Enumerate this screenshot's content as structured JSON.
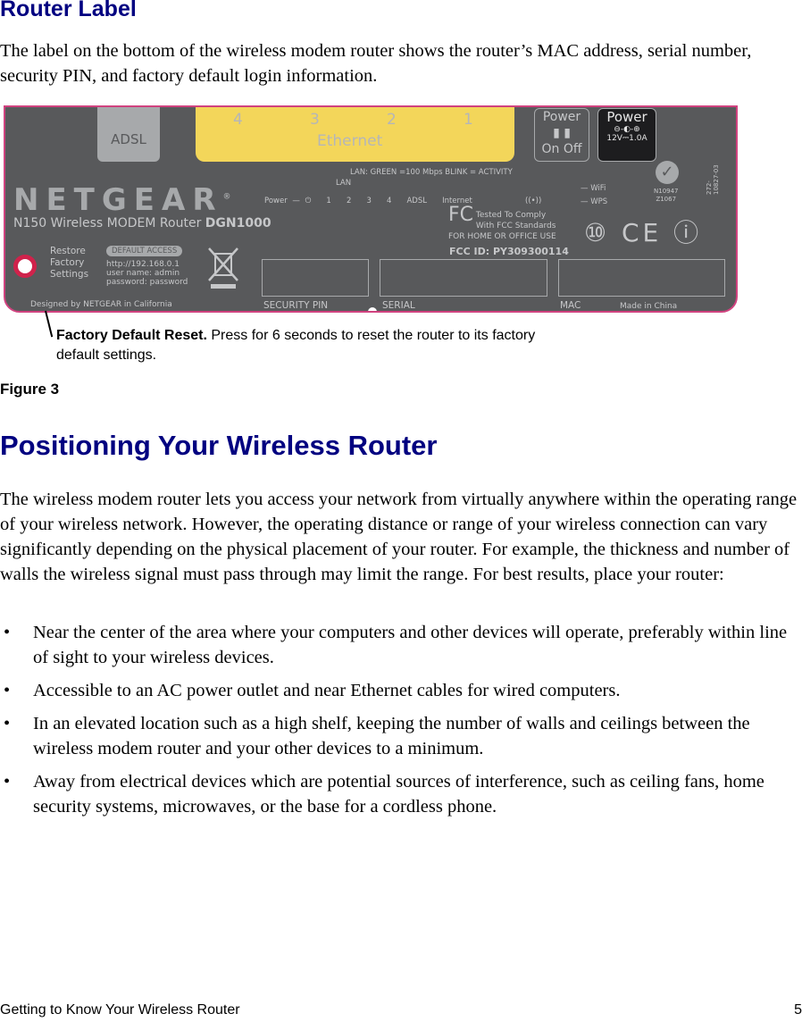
{
  "section1": {
    "heading": "Router Label",
    "intro": "The label on the bottom of the wireless modem router shows the router’s MAC address, serial number, security PIN, and factory default login information."
  },
  "figure": {
    "router_label": {
      "adsl_port": "ADSL",
      "ethernet_ports": [
        "4",
        "3",
        "2",
        "1"
      ],
      "ethernet_label": "Ethernet",
      "power_switch": {
        "title": "Power",
        "on": "On",
        "off": "Off"
      },
      "power_jack": {
        "title": "Power",
        "polarity": "⊖-◐-⊕",
        "rating": "12V⎓1.0A"
      },
      "brand": "NETGEAR",
      "brand_mark": "®",
      "model_prefix": "N150 Wireless MODEM Router",
      "model_number": "DGN1000",
      "led_legend": "LAN: GREEN =100 Mbps  BLINK = ACTIVITY",
      "led_row": "Power — ⏻   1   2   3   4   ADSL   Internet",
      "led_lan_label": "LAN",
      "wifi": "WiFi",
      "wps": "WPS",
      "restore_text": [
        "Restore",
        "Factory",
        "Settings"
      ],
      "default_access_badge": "DEFAULT ACCESS",
      "default_access_lines": [
        "http://192.168.0.1",
        "user name:  admin",
        "password:  password"
      ],
      "designed_by": "Designed by NETGEAR in California",
      "security_pin_label": "SECURITY PIN",
      "serial_label": "SERIAL",
      "mac_label": "MAC",
      "made_in": "Made in China",
      "fcc_lines": [
        "Tested To Comply",
        "With FCC Standards",
        "FOR HOME OR OFFICE USE"
      ],
      "fcc_id": "FCC ID: PY309300114",
      "ctick_codes": [
        "N10947",
        "Z1067"
      ],
      "part_number": "272-10827-03",
      "cert_marks": "⑩ CE ⓘ"
    },
    "callout_bold": "Factory Default Reset.",
    "callout_text": " Press for 6 seconds to reset the router to its factory default settings.",
    "caption": "Figure 3"
  },
  "section2": {
    "heading": "Positioning Your Wireless Router",
    "paragraph": "The wireless modem router lets you access your network from virtually anywhere within the operating range of your wireless network. However, the operating distance or range of your wireless connection can vary significantly depending on the physical placement of your router. For example, the thickness and number of walls the wireless signal must pass through may limit the range. For best results, place your router:",
    "bullet_glyph": "•",
    "bullets": [
      "Near the center of the area where your computers and other devices will operate, preferably within line of sight to your wireless devices.",
      "Accessible to an AC power outlet and near Ethernet cables for wired computers.",
      "In an elevated location such as a high shelf, keeping the number of walls and ceilings between the wireless modem router and your other devices to a minimum.",
      "Away from electrical devices which are potential sources of interference, such as ceiling fans, home security systems, microwaves, or the base for a cordless phone."
    ]
  },
  "footer": {
    "chapter": "Getting to Know Your Wireless Router",
    "page": "5"
  }
}
